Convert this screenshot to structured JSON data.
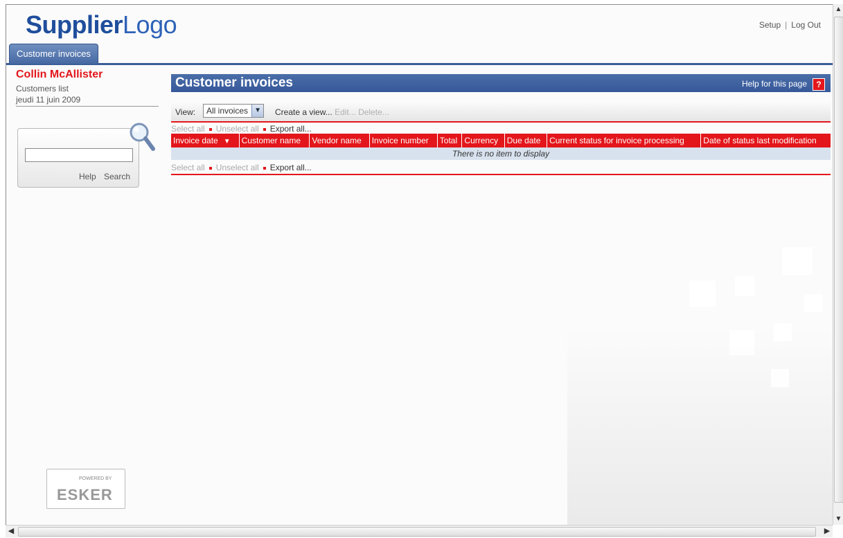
{
  "header": {
    "logo_part1": "Supplier",
    "logo_part2": "Logo",
    "nav_setup": "Setup",
    "nav_separator": "|",
    "nav_logout": "Log Out"
  },
  "tabs": [
    {
      "label": "Customer invoices",
      "active": true
    }
  ],
  "sidebar": {
    "user_name": "Collin McAllister",
    "subtitle": "Customers list",
    "date": "jeudi 11 juin 2009",
    "search": {
      "value": "",
      "help_label": "Help",
      "search_label": "Search"
    },
    "powered_by": "POWERED BY",
    "powered_brand": "ESKER"
  },
  "main": {
    "title": "Customer invoices",
    "help_label": "Help for this page",
    "help_icon": "?",
    "view_label": "View:",
    "view_selected": "All invoices",
    "create_view": "Create a view...",
    "edit": "Edit...",
    "delete": "Delete...",
    "select_all": "Select all",
    "unselect_all": "Unselect all",
    "export_all": "Export all...",
    "columns": [
      "Invoice date",
      "Customer name",
      "Vendor name",
      "Invoice number",
      "Total",
      "Currency",
      "Due date",
      "Current status for invoice processing",
      "Date of status last modification"
    ],
    "empty_message": "There is no item to display"
  },
  "colors": {
    "brand_blue": "#3a5e96",
    "accent_red": "#e3161b"
  }
}
